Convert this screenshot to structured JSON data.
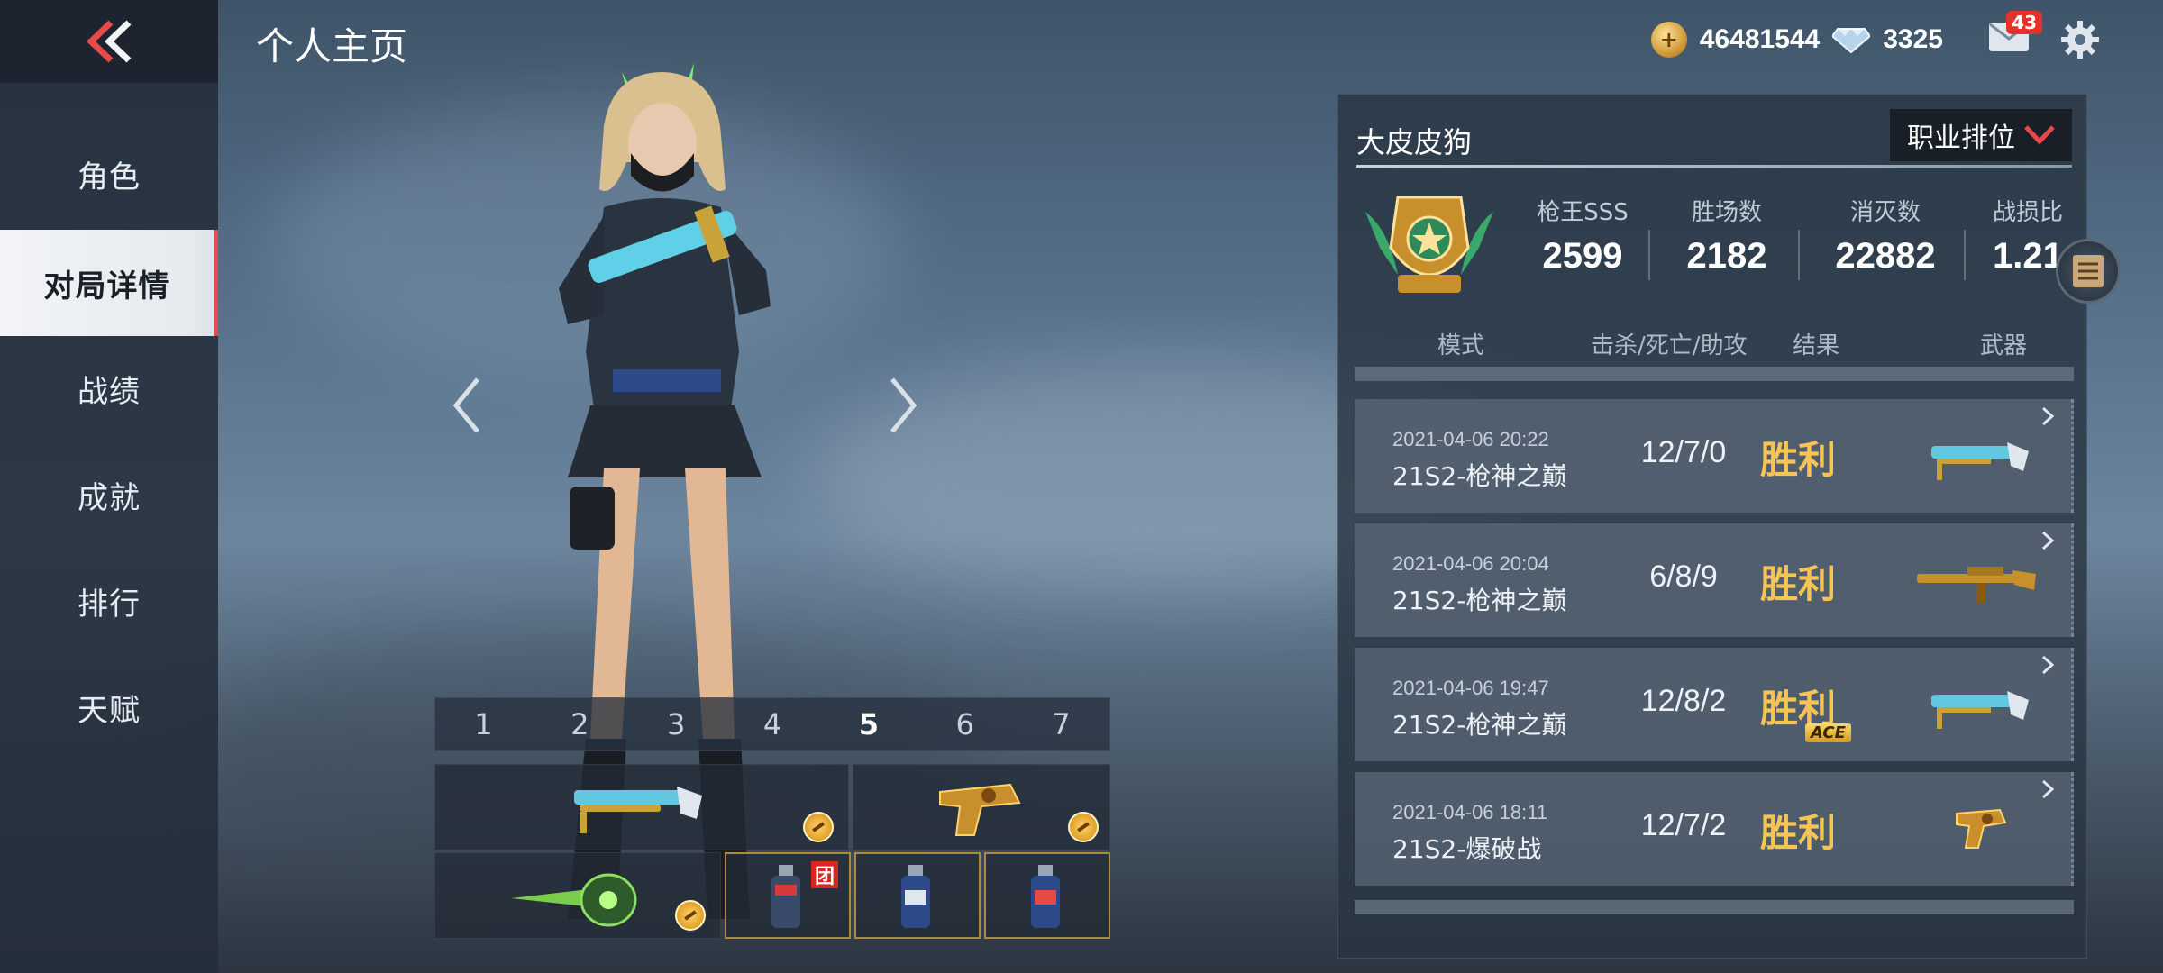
{
  "header": {
    "title": "个人主页"
  },
  "currency": {
    "gold": "46481544",
    "diamonds": "3325"
  },
  "mail": {
    "badge": "43"
  },
  "sidebar": {
    "items": [
      {
        "label": "角色"
      },
      {
        "label": "对局详情"
      },
      {
        "label": "战绩"
      },
      {
        "label": "成就"
      },
      {
        "label": "排行"
      },
      {
        "label": "天赋"
      }
    ],
    "active_index": 1
  },
  "loadout": {
    "slots": [
      "1",
      "2",
      "3",
      "4",
      "5",
      "6",
      "7"
    ],
    "active_slot": "5",
    "team_badge": "团"
  },
  "profile": {
    "name": "大皮皮狗",
    "rank_button": "职业排位",
    "stats": [
      {
        "label": "枪王SSS",
        "value": "2599"
      },
      {
        "label": "胜场数",
        "value": "2182"
      },
      {
        "label": "消灭数",
        "value": "22882"
      },
      {
        "label": "战损比",
        "value": "1.21"
      }
    ]
  },
  "matches": {
    "headers": {
      "mode": "模式",
      "kda": "击杀/死亡/助攻",
      "result": "结果",
      "weapon": "武器"
    },
    "rows": [
      {
        "date": "2021-04-06 20:22",
        "mode": "21S2-枪神之巅",
        "kda": "12/7/0",
        "result": "胜利",
        "ace": "",
        "weapon_icon": "shotgun-icon"
      },
      {
        "date": "2021-04-06 20:04",
        "mode": "21S2-枪神之巅",
        "kda": "6/8/9",
        "result": "胜利",
        "ace": "",
        "weapon_icon": "rifle-icon"
      },
      {
        "date": "2021-04-06 19:47",
        "mode": "21S2-枪神之巅",
        "kda": "12/8/2",
        "result": "胜利",
        "ace": "ACE",
        "weapon_icon": "shotgun-icon"
      },
      {
        "date": "2021-04-06 18:11",
        "mode": "21S2-爆破战",
        "kda": "12/7/2",
        "result": "胜利",
        "ace": "",
        "weapon_icon": "pistol-icon"
      }
    ]
  },
  "colors": {
    "accent_red": "#e84a4a",
    "victory_gold": "#f5c452"
  }
}
